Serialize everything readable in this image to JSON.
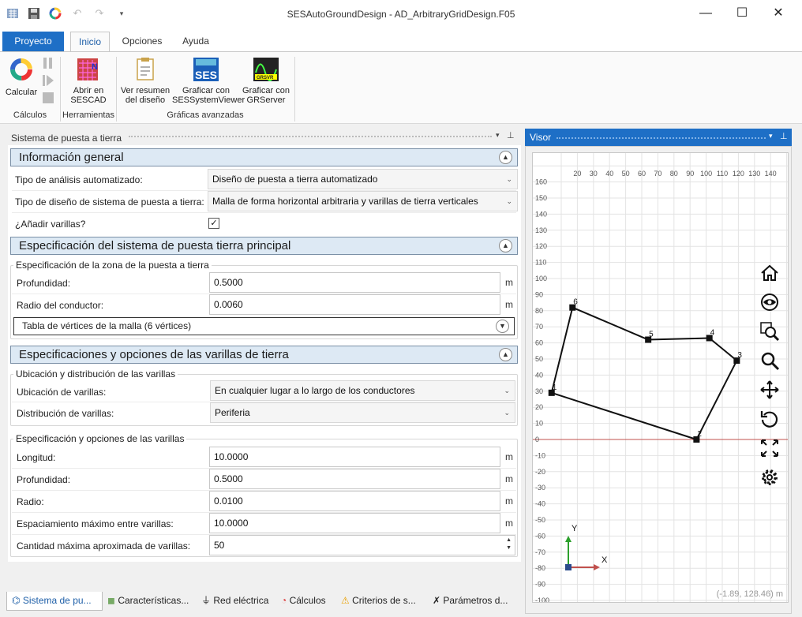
{
  "window": {
    "title": "SESAutoGroundDesign - AD_ArbitraryGridDesign.F05",
    "quick_access": [
      "app-icon",
      "save-icon",
      "calc-icon",
      "undo-icon",
      "redo-icon",
      "customize-icon"
    ],
    "controls": {
      "minimize": "—",
      "maximize": "☐",
      "close": "✕"
    }
  },
  "ribbon_tabs": [
    "Proyecto",
    "Inicio",
    "Opciones",
    "Ayuda"
  ],
  "ribbon": {
    "calcular": "Calcular",
    "abrir": [
      "Abrir en",
      "SESCAD"
    ],
    "resumen": [
      "Ver resumen",
      "del diseño"
    ],
    "graf_ses": [
      "Graficar con",
      "SESSystemViewer"
    ],
    "graf_gr": [
      "Graficar con",
      "GRServer"
    ],
    "group_calculos": "Cálculos",
    "group_herramientas": "Herramientas",
    "group_graficas": "Gráficas avanzadas"
  },
  "left_panel": {
    "title": "Sistema de puesta a tierra",
    "s1": {
      "title": "Información general",
      "analisis_label": "Tipo de análisis automatizado:",
      "analisis_value": "Diseño de puesta a tierra automatizado",
      "diseno_label": "Tipo de diseño de sistema de puesta a tierra:",
      "diseno_value": "Malla de forma horizontal arbitraria y varillas de tierra verticales",
      "varillas_label": "¿Añadir varillas?",
      "varillas_checked": "✓"
    },
    "s2": {
      "title": "Especificación del sistema de puesta tierra principal",
      "group": "Especificación de la zona de la puesta a tierra",
      "prof_label": "Profundidad:",
      "prof_value": "0.5000",
      "radio_label": "Radio del conductor:",
      "radio_value": "0.0060",
      "unit": "m",
      "tabla": "Tabla de vértices de la malla (6 vértices)"
    },
    "s3": {
      "title": "Especificaciones y opciones de las varillas de tierra",
      "group1": "Ubicación y distribución de las varillas",
      "ubic_label": "Ubicación de varillas:",
      "ubic_value": "En cualquier lugar a lo largo de los conductores",
      "dist_label": "Distribución de varillas:",
      "dist_value": "Periferia",
      "group2": "Especificación y opciones de las varillas",
      "long_label": "Longitud:",
      "long_value": "10.0000",
      "prof_label": "Profundidad:",
      "prof_value": "0.5000",
      "radio_label": "Radio:",
      "radio_value": "0.0100",
      "esp_label": "Espaciamiento máximo entre varillas:",
      "esp_value": "10.0000",
      "cant_label": "Cantidad máxima aproximada de varillas:",
      "cant_value": "50",
      "unit": "m"
    }
  },
  "bottom_tabs": [
    "Sistema de pu...",
    "Características...",
    "Red eléctrica",
    "Cálculos",
    "Criterios de s...",
    "Parámetros d..."
  ],
  "visor": {
    "title": "Visor",
    "x_ticks": [
      "20",
      "30",
      "40",
      "50",
      "60",
      "70",
      "80",
      "90",
      "100",
      "110",
      "120",
      "130",
      "140"
    ],
    "y_ticks": [
      "160",
      "150",
      "140",
      "130",
      "120",
      "110",
      "100",
      "90",
      "80",
      "70",
      "60",
      "50",
      "40",
      "30",
      "20",
      "10",
      "0",
      "-10",
      "-20",
      "-30",
      "-40",
      "-50",
      "-60",
      "-70",
      "-80",
      "-90",
      "-100"
    ],
    "coords": "(-1.89, 128.46) m",
    "axis_x": "X",
    "axis_y": "Y",
    "vertices": [
      {
        "label": "1",
        "x": 4,
        "y": 29
      },
      {
        "label": "2",
        "x": 94,
        "y": 0
      },
      {
        "label": "3",
        "x": 119,
        "y": 49
      },
      {
        "label": "4",
        "x": 102,
        "y": 63
      },
      {
        "label": "5",
        "x": 64,
        "y": 62
      },
      {
        "label": "6",
        "x": 17,
        "y": 82
      }
    ],
    "tools": [
      "home-icon",
      "eye-icon",
      "zoom-window-icon",
      "zoom-icon",
      "pan-icon",
      "rotate-icon",
      "fit-icon",
      "gear-icon"
    ]
  }
}
